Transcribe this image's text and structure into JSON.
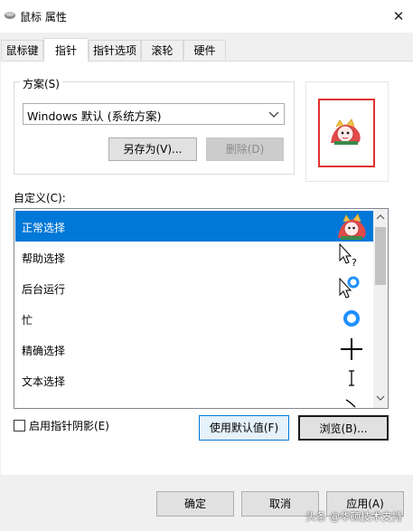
{
  "window": {
    "title": "鼠标 属性",
    "close_glyph": "✕"
  },
  "tabs": [
    {
      "label": "鼠标键",
      "selected": false
    },
    {
      "label": "指针",
      "selected": true
    },
    {
      "label": "指针选项",
      "selected": false
    },
    {
      "label": "滚轮",
      "selected": false
    },
    {
      "label": "硬件",
      "selected": false
    }
  ],
  "scheme": {
    "label": "方案(S)",
    "selected_value": "Windows 默认 (系统方案)",
    "save_as_label": "另存为(V)...",
    "delete_label": "删除(D)"
  },
  "custom": {
    "label": "自定义(C):",
    "items": [
      {
        "label": "正常选择",
        "icon": "cartoon-cursor-icon",
        "selected": true
      },
      {
        "label": "帮助选择",
        "icon": "help-select-cursor-icon",
        "selected": false
      },
      {
        "label": "后台运行",
        "icon": "working-in-background-cursor-icon",
        "selected": false
      },
      {
        "label": "忙",
        "icon": "busy-cursor-icon",
        "selected": false
      },
      {
        "label": "精确选择",
        "icon": "precision-select-cursor-icon",
        "selected": false
      },
      {
        "label": "文本选择",
        "icon": "text-select-cursor-icon",
        "selected": false
      },
      {
        "label": "",
        "icon": "handwriting-cursor-icon",
        "selected": false
      }
    ]
  },
  "shadow": {
    "label": "启用指针阴影(E)",
    "checked": false
  },
  "buttons": {
    "use_default": "使用默认值(F)",
    "browse": "浏览(B)...",
    "ok": "确定",
    "cancel": "取消",
    "apply": "应用(A)"
  },
  "watermark": "头条 @华硕技术支持",
  "colors": {
    "selection": "#0078d7",
    "highlight_box": "#e23131"
  }
}
